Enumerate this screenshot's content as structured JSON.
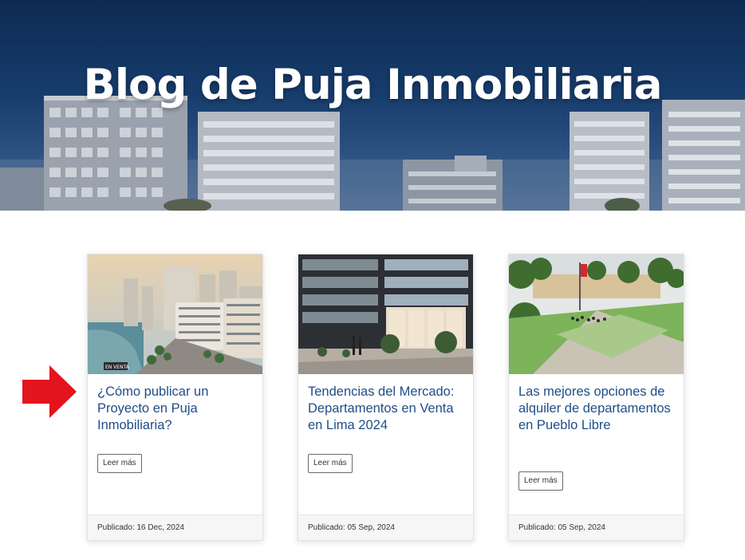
{
  "hero": {
    "title": "Blog de Puja Inmobiliaria"
  },
  "posts": [
    {
      "title": "¿Cómo publicar un Proyecto en Puja Inmobiliaria?",
      "read_more": "Leer más",
      "published_label": "Publicado:",
      "date": "16 Dec, 2024"
    },
    {
      "title": "Tendencias del Mercado: Departamentos en Venta en Lima 2024",
      "read_more": "Leer más",
      "published_label": "Publicado:",
      "date": "05 Sep, 2024"
    },
    {
      "title": "Las mejores opciones de alquiler de departamentos en Pueblo Libre",
      "read_more": "Leer más",
      "published_label": "Publicado:",
      "date": "05 Sep, 2024"
    }
  ],
  "thumb1": {
    "sign_text": "EN VENTA"
  },
  "colors": {
    "link": "#1d4e89",
    "arrow": "#e3141d",
    "hero": "#173d6d"
  },
  "icons": {
    "pointer": "red-arrow-right-icon"
  }
}
